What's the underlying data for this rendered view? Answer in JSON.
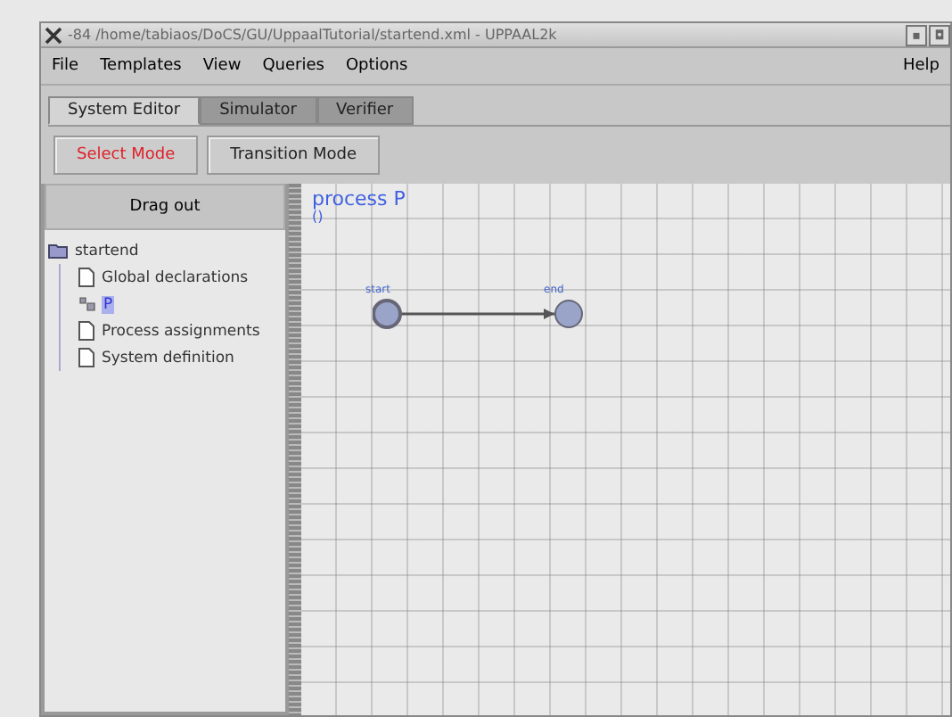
{
  "window": {
    "title": "-84 /home/tabiaos/DoCS/GU/UppaalTutorial/startend.xml - UPPAAL2k",
    "controls": [
      "▪",
      "◘"
    ]
  },
  "menu": [
    "File",
    "Templates",
    "View",
    "Queries",
    "Options"
  ],
  "help": "Help",
  "tabs": [
    {
      "label": "System Editor",
      "selected": true
    },
    {
      "label": "Simulator",
      "selected": false
    },
    {
      "label": "Verifier",
      "selected": false
    }
  ],
  "modes": [
    {
      "label": "Select Mode",
      "selected": true
    },
    {
      "label": "Transition Mode",
      "selected": false
    }
  ],
  "panel": {
    "header": "Drag out",
    "tree": {
      "label": "startend",
      "children": [
        {
          "label": "Global declarations",
          "kind": "doc",
          "selected": false
        },
        {
          "label": "P",
          "kind": "template",
          "selected": true
        },
        {
          "label": "Process assignments",
          "kind": "doc",
          "selected": false
        },
        {
          "label": "System definition",
          "kind": "doc",
          "selected": false
        }
      ]
    }
  },
  "canvas": {
    "title": "process P",
    "params": "()",
    "locations": [
      {
        "name": "start",
        "initial": true
      },
      {
        "name": "end",
        "initial": false
      }
    ]
  }
}
